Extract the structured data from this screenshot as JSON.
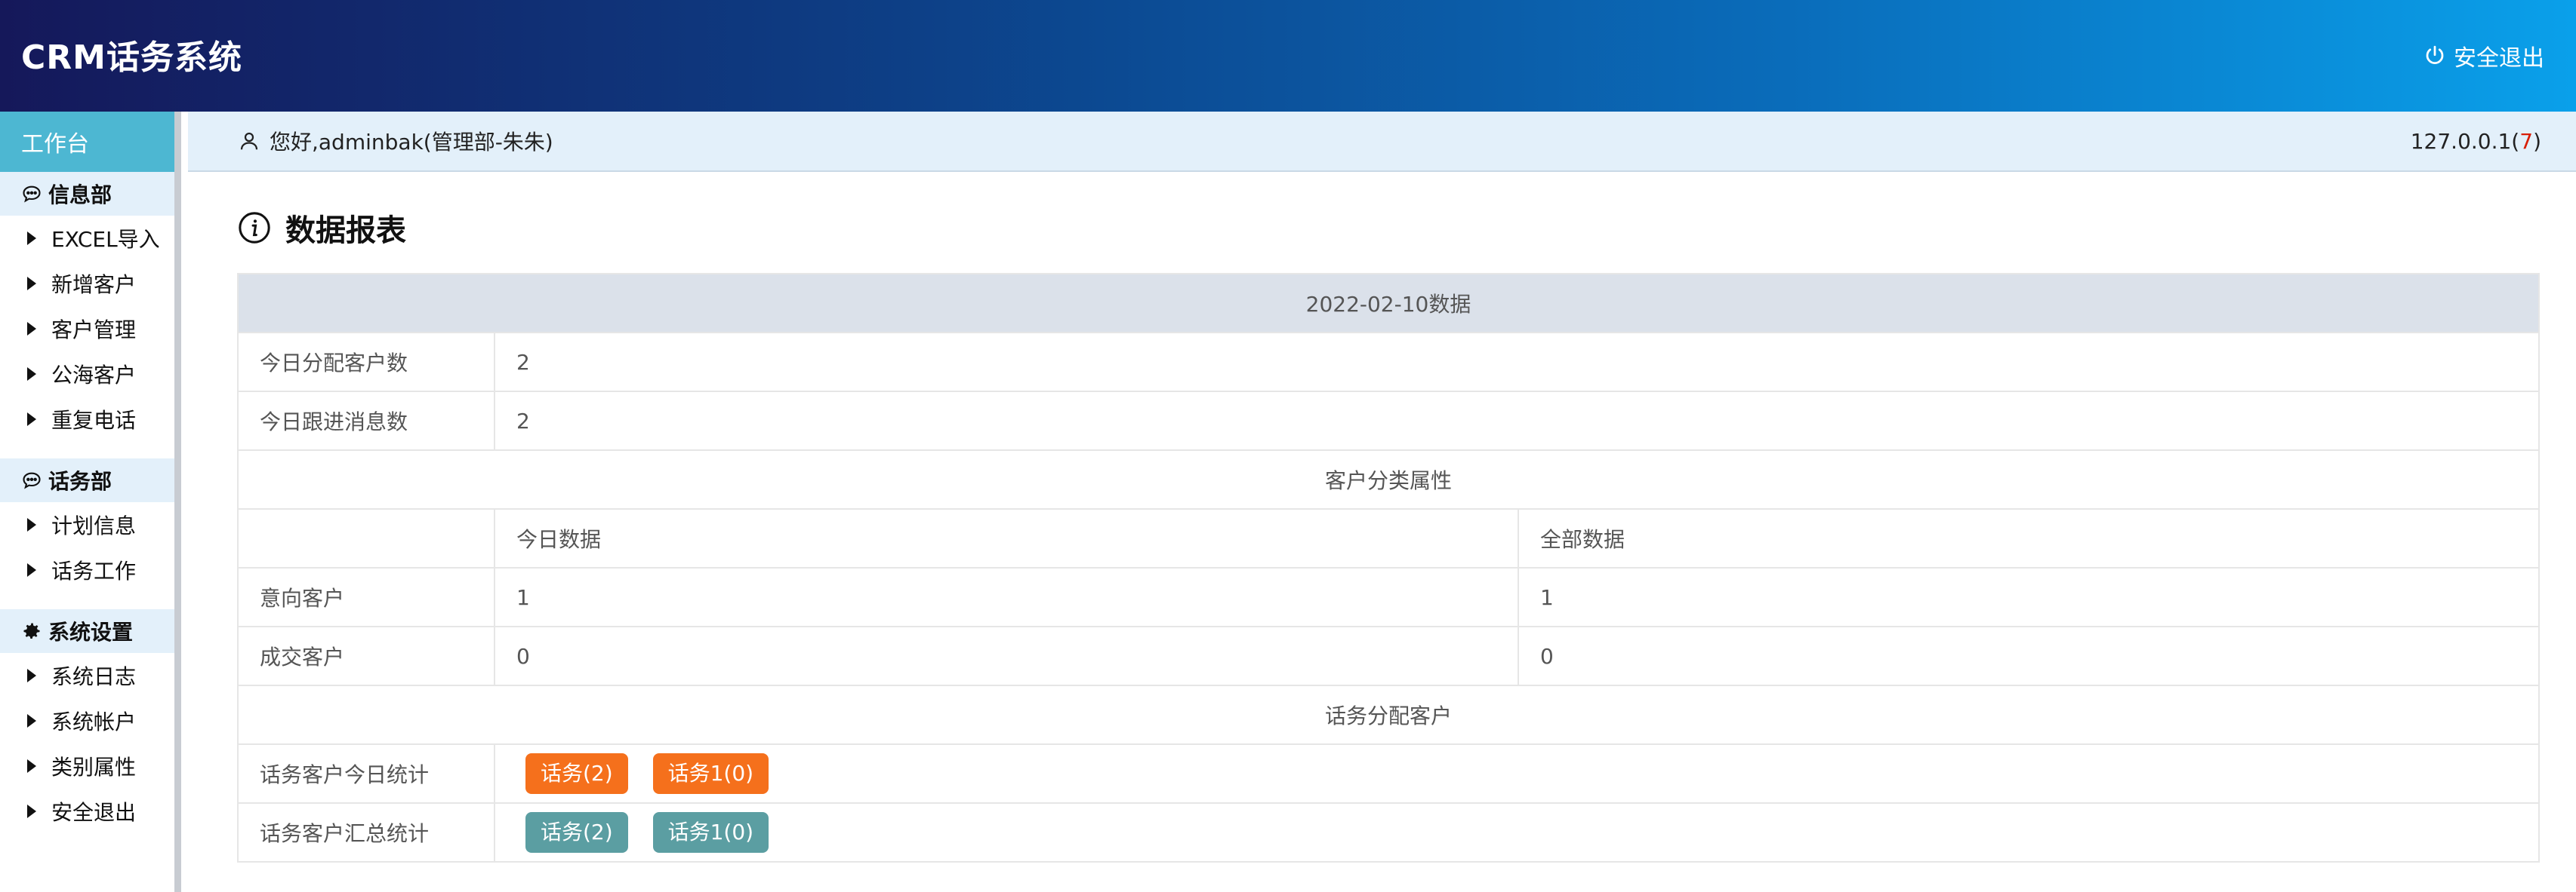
{
  "header": {
    "brand": "CRM话务系统",
    "logout_label": "安全退出"
  },
  "sidebar": {
    "top_label": "工作台",
    "sections": [
      {
        "title": "信息部",
        "items": [
          "EXCEL导入",
          "新增客户",
          "客户管理",
          "公海客户",
          "重复电话"
        ]
      },
      {
        "title": "话务部",
        "items": [
          "计划信息",
          "话务工作"
        ]
      },
      {
        "title": "系统设置",
        "items": [
          "系统日志",
          "系统帐户",
          "类别属性",
          "安全退出"
        ]
      }
    ]
  },
  "infobar": {
    "greeting": "您好,adminbak(管理部-朱朱)",
    "ip": "127.0.0.1(",
    "ip_count": "7",
    "ip_close": ")"
  },
  "page": {
    "title": "数据报表"
  },
  "report": {
    "date_header": "2022-02-10数据",
    "today_assigned_label": "今日分配客户数",
    "today_assigned_value": "2",
    "today_followup_label": "今日跟进消息数",
    "today_followup_value": "2",
    "category_header": "客户分类属性",
    "today_data_label": "今日数据",
    "all_data_label": "全部数据",
    "rows": [
      {
        "label": "意向客户",
        "today": "1",
        "all": "1"
      },
      {
        "label": "成交客户",
        "today": "0",
        "all": "0"
      }
    ],
    "assign_header": "话务分配客户",
    "today_stats_label": "话务客户今日统计",
    "today_stats_buttons": [
      "话务(2)",
      "话务1(0)"
    ],
    "total_stats_label": "话务客户汇总统计",
    "total_stats_buttons": [
      "话务(2)",
      "话务1(0)"
    ]
  },
  "colors": {
    "header_gradient_start": "#15185a",
    "header_gradient_end": "#0aa0ea",
    "sidebar_top": "#4db7d2",
    "btn_orange": "#f5701c",
    "btn_teal": "#5b9ea2"
  }
}
